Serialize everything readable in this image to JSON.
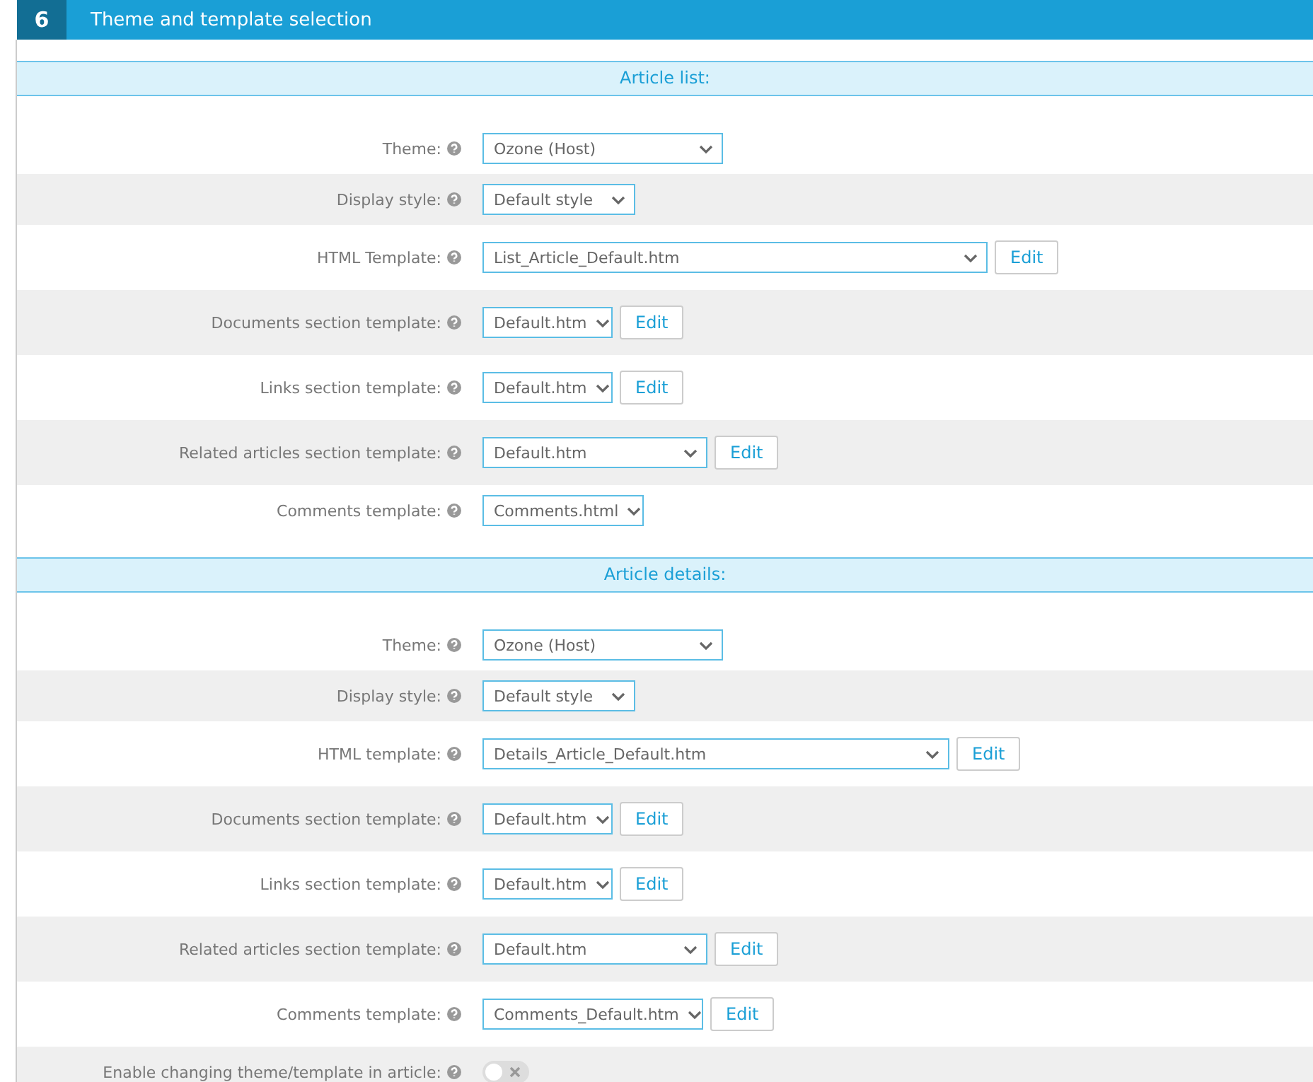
{
  "panel": {
    "number": "6",
    "title": "Theme and template selection"
  },
  "sections": [
    {
      "title": "Article list:",
      "rows": [
        {
          "kind": "select",
          "label": "Theme:",
          "value": "Ozone (Host)"
        },
        {
          "kind": "select",
          "label": "Display style:",
          "value": "Default style"
        },
        {
          "kind": "select",
          "label": "HTML Template:",
          "value": "List_Article_Default.htm",
          "button": "Edit"
        },
        {
          "kind": "select",
          "label": "Documents section template:",
          "value": "Default.htm",
          "button": "Edit"
        },
        {
          "kind": "select",
          "label": "Links section template:",
          "value": "Default.htm",
          "button": "Edit"
        },
        {
          "kind": "select",
          "label": "Related articles section template:",
          "value": "Default.htm",
          "button": "Edit"
        },
        {
          "kind": "select",
          "label": "Comments template:",
          "value": "Comments.html"
        }
      ]
    },
    {
      "title": "Article details:",
      "rows": [
        {
          "kind": "select",
          "label": "Theme:",
          "value": "Ozone (Host)"
        },
        {
          "kind": "select",
          "label": "Display style:",
          "value": "Default style"
        },
        {
          "kind": "select",
          "label": "HTML template:",
          "value": "Details_Article_Default.htm",
          "button": "Edit"
        },
        {
          "kind": "select",
          "label": "Documents section template:",
          "value": "Default.htm",
          "button": "Edit"
        },
        {
          "kind": "select",
          "label": "Links section template:",
          "value": "Default.htm",
          "button": "Edit"
        },
        {
          "kind": "select",
          "label": "Related articles section template:",
          "value": "Default.htm",
          "button": "Edit"
        },
        {
          "kind": "select",
          "label": "Comments template:",
          "value": "Comments_Default.htm",
          "button": "Edit"
        },
        {
          "kind": "toggle",
          "label": "Enable changing theme/template in article:",
          "on": false
        }
      ]
    }
  ]
}
